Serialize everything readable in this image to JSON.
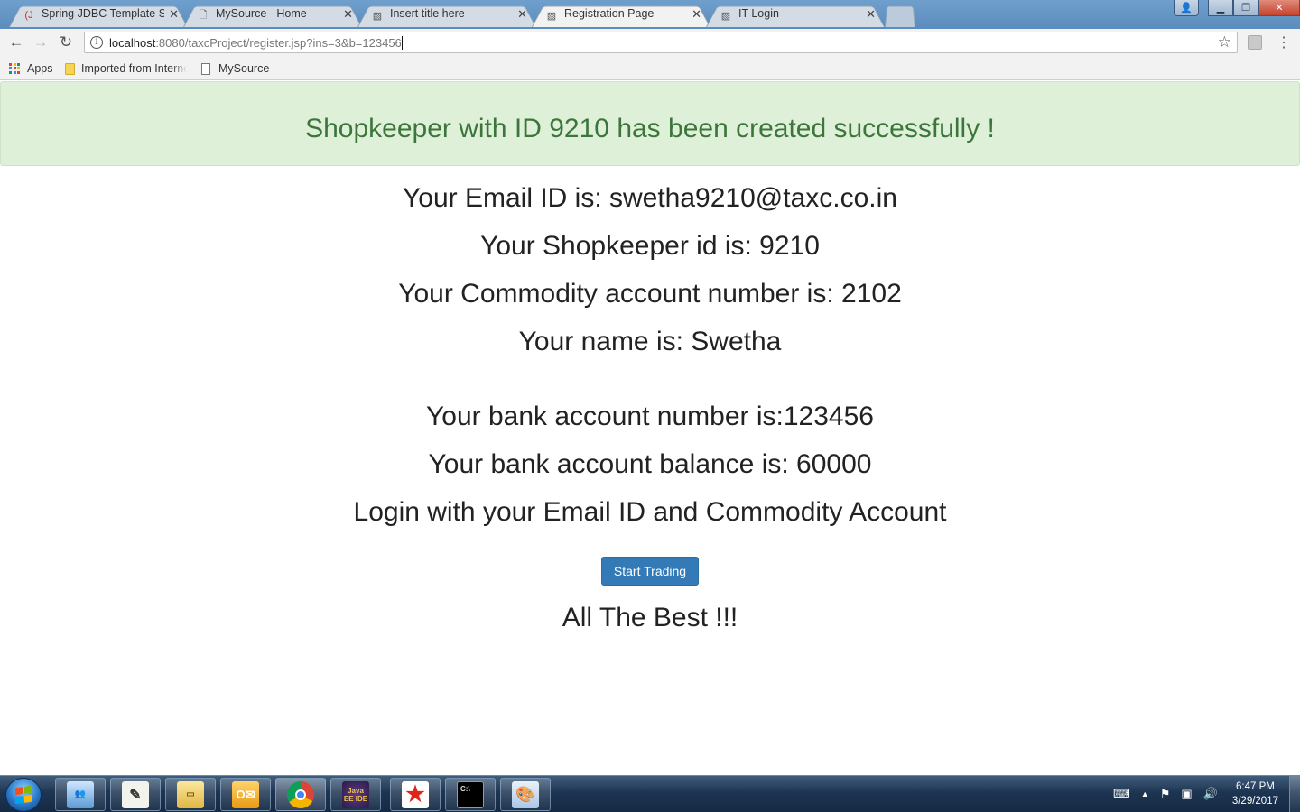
{
  "browser": {
    "tabs": [
      {
        "title": "Spring JDBC Template Si",
        "favicon": "java-icon",
        "active": false
      },
      {
        "title": "MySource - Home",
        "favicon": "page-icon",
        "active": false
      },
      {
        "title": "Insert title here",
        "favicon": "eclipse-page-icon",
        "active": false
      },
      {
        "title": "Registration Page",
        "favicon": "eclipse-page-icon",
        "active": true
      },
      {
        "title": "IT Login",
        "favicon": "eclipse-page-icon",
        "active": false
      }
    ],
    "url_host": "localhost",
    "url_rest": ":8080/taxcProject/register.jsp?ins=3&b=123456",
    "bookmarks": {
      "apps": "Apps",
      "imported": "Imported from Interne",
      "mysource": "MySource"
    }
  },
  "page": {
    "alert": "Shopkeeper with ID 9210 has been created successfully !",
    "email_line": "Your Email ID is: swetha9210@taxc.co.in",
    "shopkeeper_line": "Your Shopkeeper id is: 9210",
    "commodity_line": "Your Commodity account number is: 2102",
    "name_line": "Your name is: Swetha",
    "bank_account_line": "Your bank account number is:123456",
    "bank_balance_line": "Your bank account balance is: 60000",
    "login_hint": "Login with your Email ID and Commodity Account",
    "start_button": "Start Trading",
    "farewell": "All The Best !!!",
    "colors": {
      "alert_bg": "#dff0d8",
      "alert_text": "#3c763d",
      "button_bg": "#337ab7"
    }
  },
  "taskbar": {
    "apps": [
      "outlook-contacts-icon",
      "notepad-icon",
      "file-explorer-icon",
      "outlook-icon",
      "chrome-icon",
      "java-ee-ide-icon",
      "star-app-icon",
      "command-prompt-icon",
      "paint-icon"
    ],
    "eclipse_label": "Java EE IDE",
    "cmd_label": "C:\\",
    "time": "6:47 PM",
    "date": "3/29/2017"
  }
}
